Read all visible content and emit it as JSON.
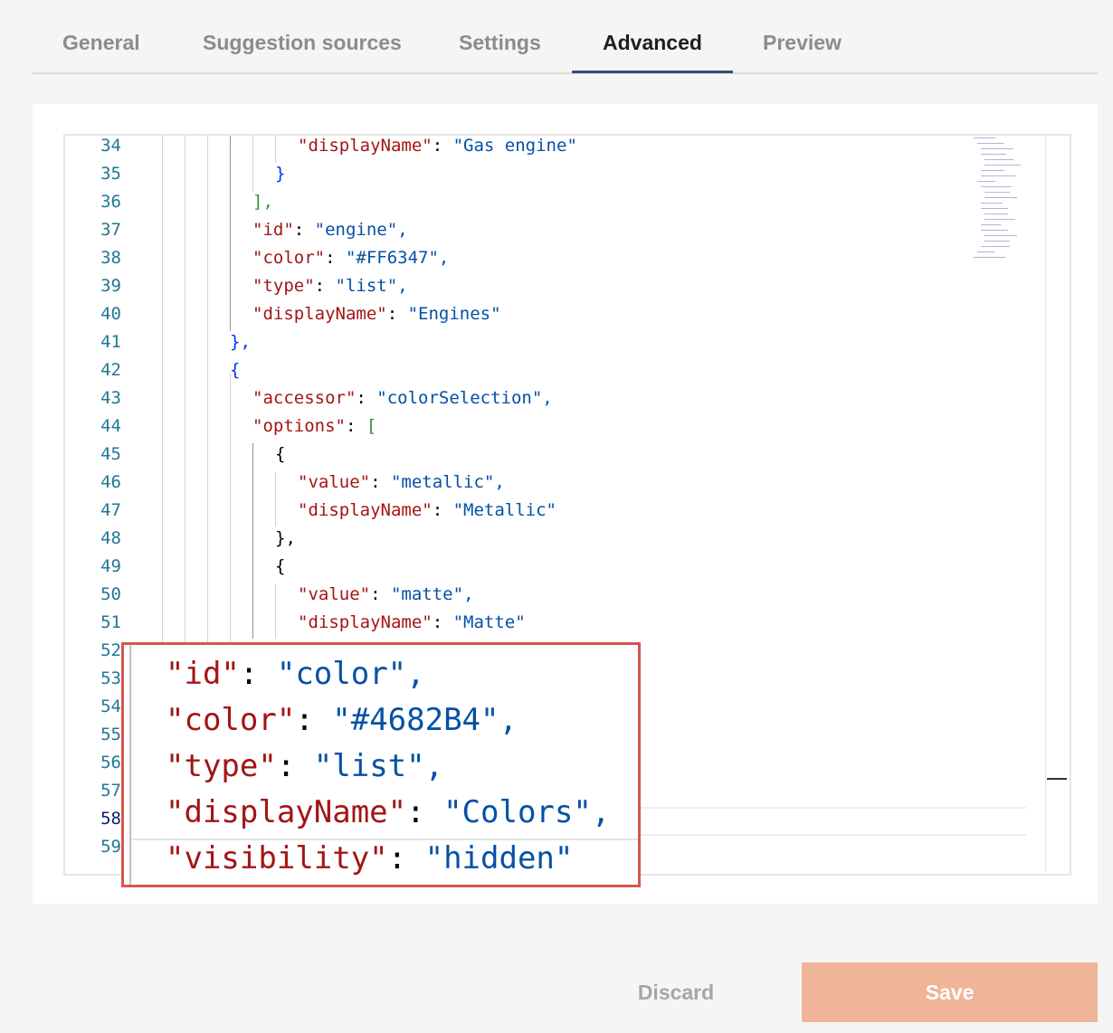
{
  "tabs": [
    {
      "label": "General"
    },
    {
      "label": "Suggestion sources"
    },
    {
      "label": "Settings"
    },
    {
      "label": "Advanced",
      "active": true
    },
    {
      "label": "Preview"
    }
  ],
  "editor": {
    "line_numbers": [
      "34",
      "35",
      "36",
      "37",
      "38",
      "39",
      "40",
      "41",
      "42",
      "43",
      "44",
      "45",
      "46",
      "47",
      "48",
      "49",
      "50",
      "51",
      "52",
      "53",
      "54",
      "55",
      "56",
      "57",
      "58",
      "59"
    ],
    "current_line": "58",
    "lines": [
      {
        "key": "\"displayName\"",
        "value": "\"Gas engine\""
      },
      {
        "punct": "}"
      },
      {
        "punct": "],"
      },
      {
        "key": "\"id\"",
        "value": "\"engine\","
      },
      {
        "key": "\"color\"",
        "value": "\"#FF6347\","
      },
      {
        "key": "\"type\"",
        "value": "\"list\","
      },
      {
        "key": "\"displayName\"",
        "value": "\"Engines\""
      },
      {
        "punct": "},"
      },
      {
        "punct": "{"
      },
      {
        "key": "\"accessor\"",
        "value": "\"colorSelection\","
      },
      {
        "key": "\"options\"",
        "punct": "["
      },
      {
        "punct": "{"
      },
      {
        "key": "\"value\"",
        "value": "\"metallic\","
      },
      {
        "key": "\"displayName\"",
        "value": "\"Metallic\""
      },
      {
        "punct": "},"
      },
      {
        "punct": "{"
      },
      {
        "key": "\"value\"",
        "value": "\"matte\","
      },
      {
        "key": "\"displayName\"",
        "value": "\"Matte\""
      }
    ]
  },
  "zoom": {
    "lines": [
      {
        "key": "\"id\"",
        "value": "\"color\","
      },
      {
        "key": "\"color\"",
        "value": "\"#4682B4\","
      },
      {
        "key": "\"type\"",
        "value": "\"list\","
      },
      {
        "key": "\"displayName\"",
        "value": "\"Colors\","
      },
      {
        "key": "\"visibility\"",
        "value": "\"hidden\""
      }
    ]
  },
  "actions": {
    "discard_label": "Discard",
    "save_label": "Save"
  },
  "colors": {
    "accent": "#2d4f7c",
    "save_button": "#f0b499",
    "highlight_border": "#d9534f",
    "json_key": "#a31515",
    "json_string": "#0451a5",
    "line_number": "#237893"
  }
}
